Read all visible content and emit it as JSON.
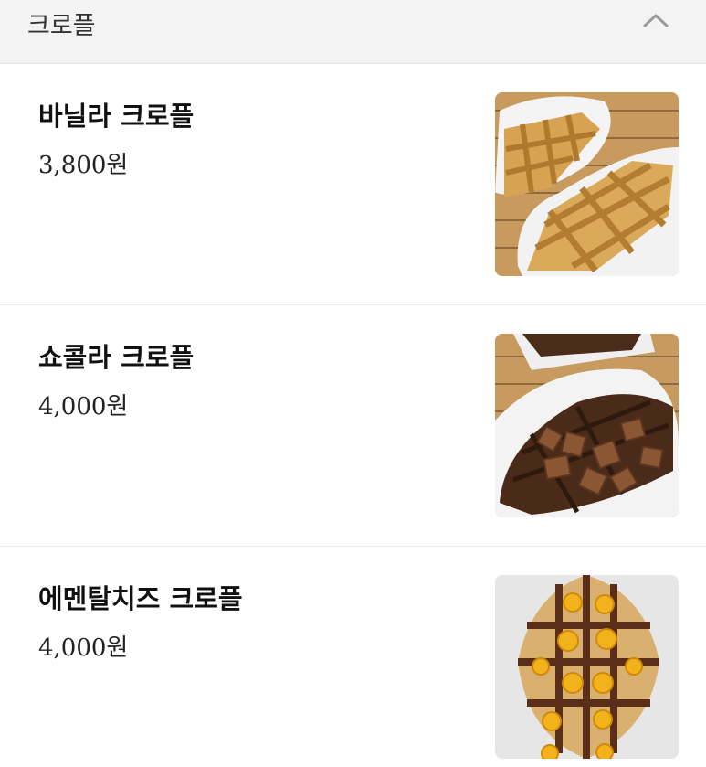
{
  "section": {
    "title": "크로플",
    "toggle_icon": "chevron-up-icon"
  },
  "items": [
    {
      "name": "바닐라 크로플",
      "price": "3,800원",
      "image": "vanilla-croffle-photo"
    },
    {
      "name": "쇼콜라 크로플",
      "price": "4,000원",
      "image": "chocolate-croffle-photo"
    },
    {
      "name": "에멘탈치즈 크로플",
      "price": "4,000원",
      "image": "emmental-cheese-croffle-photo"
    }
  ],
  "colors": {
    "header_bg": "#f3f3f3",
    "divider": "#ebebeb",
    "text": "#111111"
  }
}
